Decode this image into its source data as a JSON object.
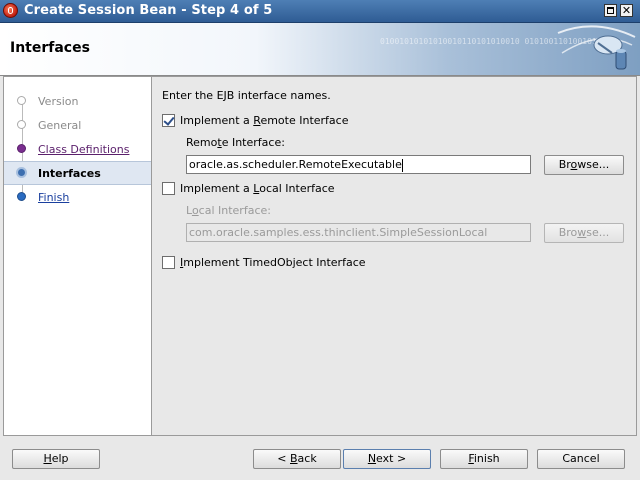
{
  "window": {
    "title": "Create Session Bean - Step 4 of 5"
  },
  "header": {
    "title": "Interfaces",
    "decor_text": "01001010101010010110101010010 0101001101001010101"
  },
  "steps": [
    {
      "label": "Version",
      "state": "done"
    },
    {
      "label": "General",
      "state": "done"
    },
    {
      "label": "Class Definitions",
      "state": "link"
    },
    {
      "label": "Interfaces",
      "state": "current"
    },
    {
      "label": "Finish",
      "state": "finish"
    }
  ],
  "content": {
    "instruction": "Enter the EJB interface names.",
    "remote": {
      "checked": true,
      "checkbox_pre": "Implement a ",
      "checkbox_mn": "R",
      "checkbox_post": "emote Interface",
      "label_pre": "Remo",
      "label_mn": "t",
      "label_post": "e Interface:",
      "value": "oracle.as.scheduler.RemoteExecutable",
      "browse_pre": "Br",
      "browse_mn": "o",
      "browse_post": "wse..."
    },
    "local": {
      "checked": false,
      "checkbox_pre": "Implement a ",
      "checkbox_mn": "L",
      "checkbox_post": "ocal Interface",
      "label_pre": "L",
      "label_mn": "o",
      "label_post": "cal Interface:",
      "value": "com.oracle.samples.ess.thinclient.SimpleSessionLocal",
      "browse_pre": "Bro",
      "browse_mn": "w",
      "browse_post": "se..."
    },
    "timed": {
      "checked": false,
      "checkbox_pre": "",
      "checkbox_mn": "I",
      "checkbox_post": "mplement TimedObject Interface"
    }
  },
  "buttons": {
    "help": {
      "mn": "H",
      "post": "elp"
    },
    "back": {
      "pre": "< ",
      "mn": "B",
      "post": "ack"
    },
    "next": {
      "mn": "N",
      "post": "ext >"
    },
    "finish": {
      "mn": "F",
      "post": "inish"
    },
    "cancel": {
      "label": "Cancel"
    }
  },
  "colors": {
    "title_bar": "#3a6aa3",
    "link_visited": "#5a1f6b",
    "link": "#1a3f9e",
    "current_step_bg": "#dfe7f2"
  }
}
